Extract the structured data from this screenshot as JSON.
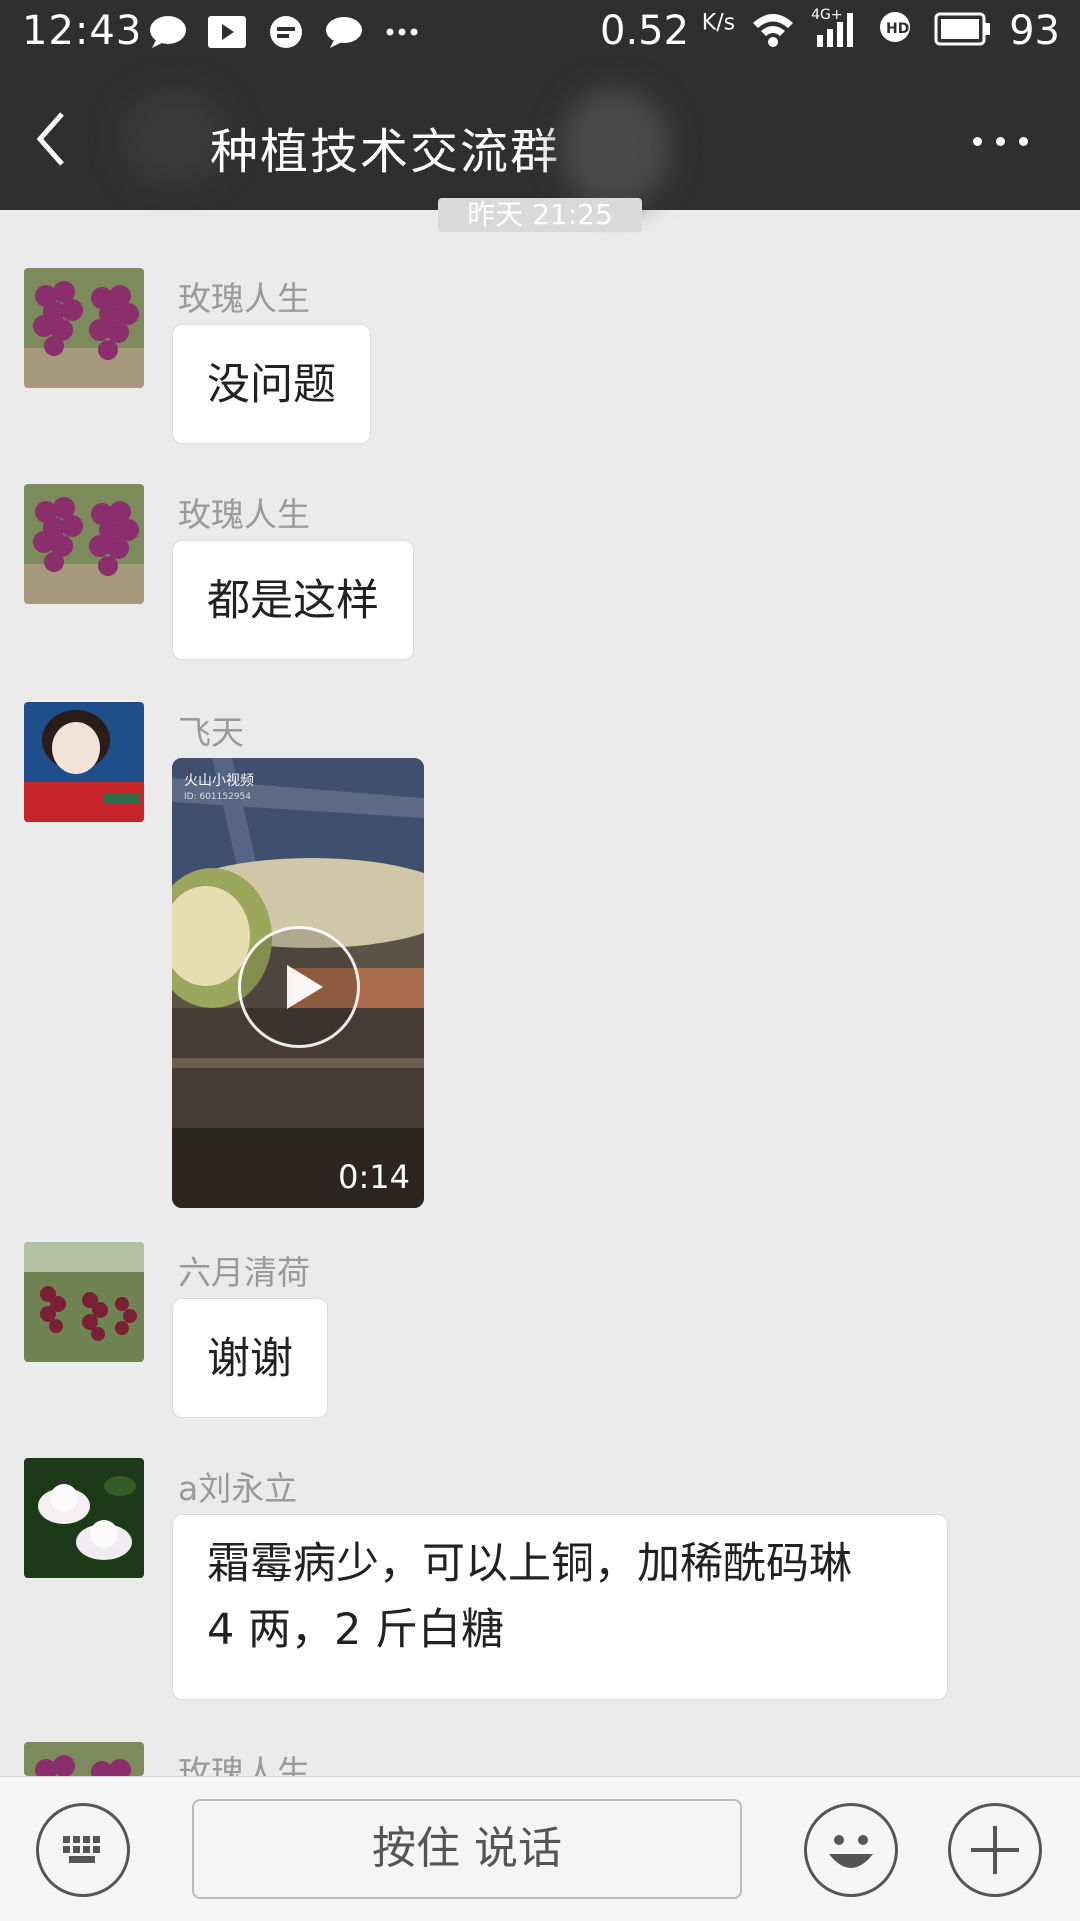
{
  "status_bar": {
    "time": "12:43",
    "speed_value": "0.52",
    "speed_unit": "K/s",
    "network_label": "4G+",
    "battery_level": "93",
    "left_icons": [
      "chat-bubble-icon",
      "play-icon",
      "message-icon",
      "chat-bubble-icon",
      "more-dots-icon"
    ],
    "right_icons": [
      "wifi-icon",
      "cell-signal-icon",
      "hd-call-icon",
      "battery-icon"
    ]
  },
  "header": {
    "title": "种植技术交流群",
    "back_icon": "back-arrow-icon",
    "more_icon": "more-horizontal-icon"
  },
  "timestamp": "昨天 21:25",
  "messages": [
    {
      "sender": "玫瑰人生",
      "text": "没问题",
      "avatar": "grapes-avatar"
    },
    {
      "sender": "玫瑰人生",
      "text": "都是这样",
      "avatar": "grapes-avatar"
    },
    {
      "sender": "飞天",
      "video": {
        "watermark": "火山小视频",
        "id": "ID: 601152954",
        "duration": "0:14"
      },
      "avatar": "woman-avatar"
    },
    {
      "sender": "六月清荷",
      "text": "谢谢",
      "avatar": "grape-vine-avatar"
    },
    {
      "sender": "a刘永立",
      "text_line1": "霜霉病少，可以上铜，加稀酰码琳",
      "text_line2": "4 两，2 斤白糖",
      "avatar": "lotus-avatar"
    },
    {
      "sender": "玫瑰人生",
      "avatar": "grapes-avatar"
    }
  ],
  "input_bar": {
    "talk_label": "按住 说话",
    "keyboard_icon": "keyboard-icon",
    "emoji_icon": "emoji-icon",
    "plus_icon": "plus-icon"
  }
}
